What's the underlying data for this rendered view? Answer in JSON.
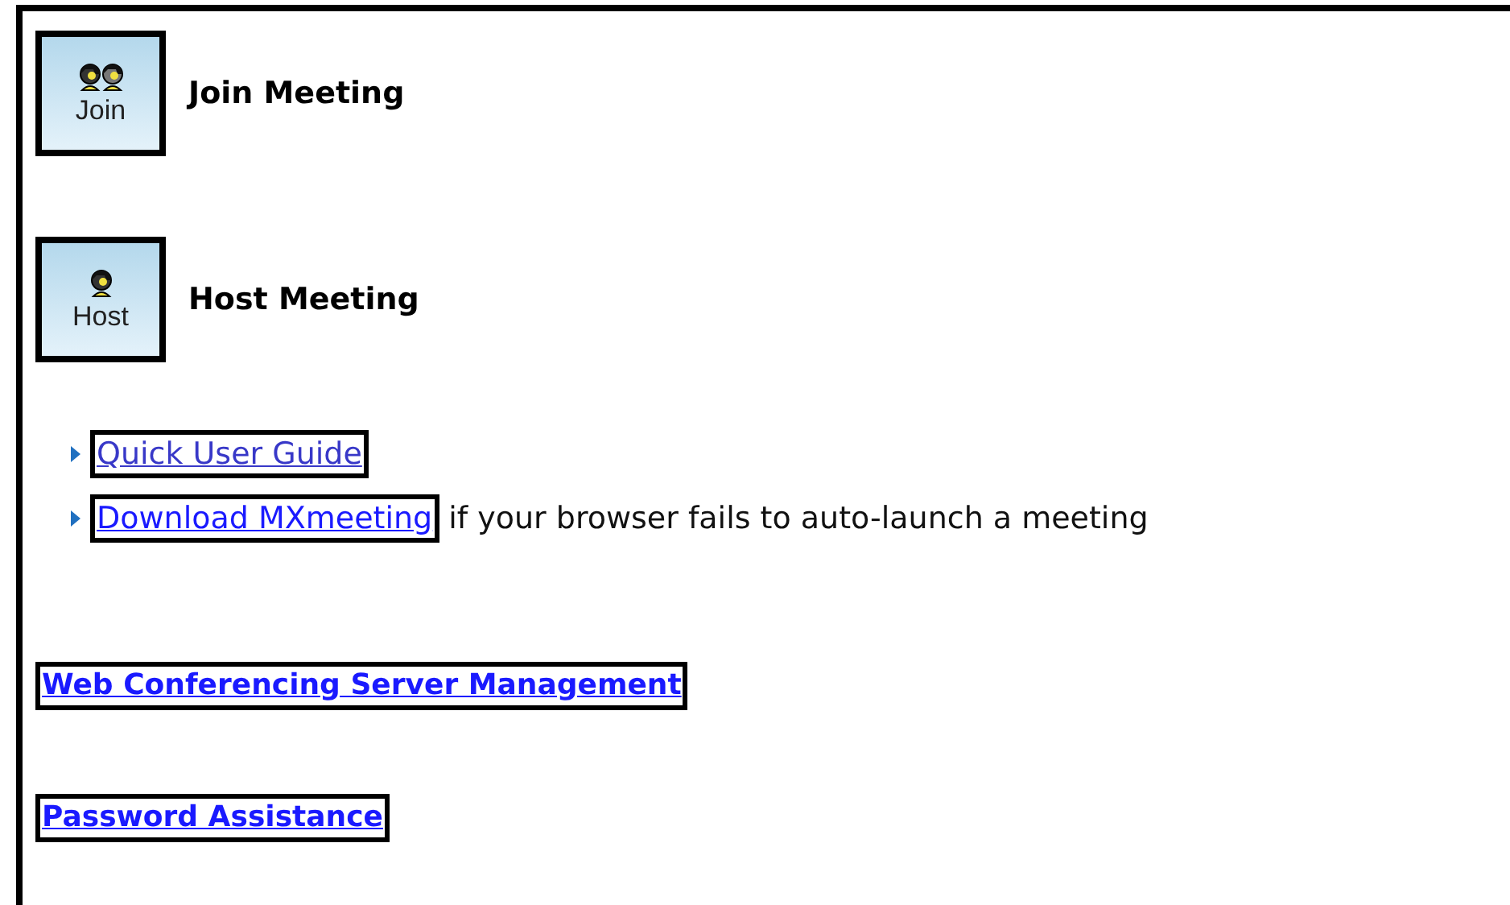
{
  "actions": [
    {
      "kind": "join",
      "button_label": "Join",
      "title": "Join Meeting"
    },
    {
      "kind": "host",
      "button_label": "Host",
      "title": "Host Meeting"
    }
  ],
  "resources": [
    {
      "link": "Quick User Guide"
    },
    {
      "link": "Download MXmeeting",
      "note": "if your browser fails to auto-launch a meeting"
    }
  ],
  "admin_links": [
    "Web Conferencing Server Management",
    "Password Assistance"
  ]
}
